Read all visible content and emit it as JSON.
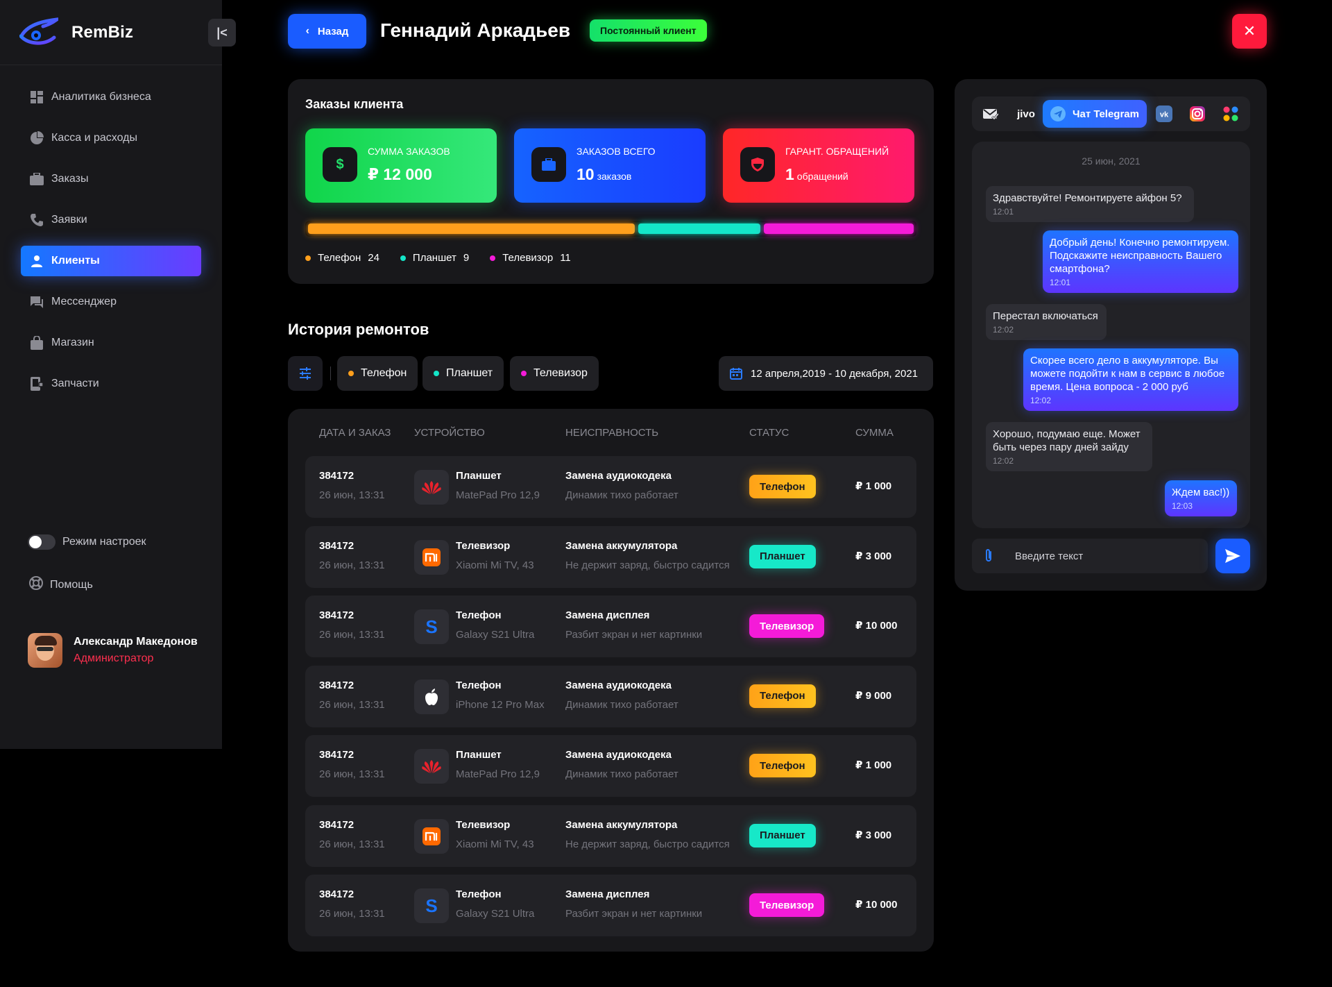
{
  "app": {
    "name": "RemBiz",
    "collapse_glyph": "|<"
  },
  "sidebar": {
    "items": [
      {
        "label": "Аналитика бизнеса",
        "icon": "dashboard-icon"
      },
      {
        "label": "Касса и расходы",
        "icon": "pie-chart-icon"
      },
      {
        "label": "Заказы",
        "icon": "briefcase-icon"
      },
      {
        "label": "Заявки",
        "icon": "phone-icon"
      },
      {
        "label": "Клиенты",
        "icon": "user-icon",
        "active": true
      },
      {
        "label": "Мессенджер",
        "icon": "chat-icon"
      },
      {
        "label": "Магазин",
        "icon": "shopping-bag-icon"
      },
      {
        "label": "Запчасти",
        "icon": "device-icon"
      }
    ],
    "settings_toggle": {
      "label": "Режим настроек",
      "on": false
    },
    "help_label": "Помощь",
    "user": {
      "name": "Александр Македонов",
      "role": "Администратор"
    }
  },
  "header": {
    "back_label": "Назад",
    "client_name": "Геннадий Аркадьев",
    "client_badge": "Постоянный клиент"
  },
  "orders": {
    "title": "Заказы клиента",
    "stats": [
      {
        "label": "Сумма заказов",
        "value": "₽ 12 000",
        "unit": "",
        "icon": "dollar-icon",
        "color": "#10d54a"
      },
      {
        "label": "Заказов всего",
        "value": "10",
        "unit": "заказов",
        "icon": "briefcase-icon",
        "color": "#1663ff"
      },
      {
        "label": "Гарант. обращений",
        "value": "1",
        "unit": "обращений",
        "icon": "shield-icon",
        "color": "#ff2727"
      }
    ],
    "breakdown": [
      {
        "name": "Телефон",
        "count": 24,
        "color": "#ff9f1c"
      },
      {
        "name": "Планшет",
        "count": 9,
        "color": "#14e6c8"
      },
      {
        "name": "Телевизор",
        "count": 11,
        "color": "#f41bd8"
      }
    ]
  },
  "history": {
    "title": "История ремонтов",
    "filters": [
      "Телефон",
      "Планшет",
      "Телевизор"
    ],
    "date_range": "12 апреля,2019 - 10 декабря, 2021",
    "columns": [
      "Дата и заказ",
      "Устройство",
      "Неисправность",
      "Статус",
      "Сумма"
    ],
    "rows": [
      {
        "order": "384172",
        "date": "26 июн, 13:31",
        "brand": "huawei-logo-icon",
        "device": "Планшет",
        "model": "MatePad Pro 12,9",
        "fault": "Замена аудиокодека",
        "fault_desc": "Динамик тихо работает",
        "status": "Телефон",
        "status_color": "orange",
        "sum": "₽ 1 000"
      },
      {
        "order": "384172",
        "date": "26 июн, 13:31",
        "brand": "xiaomi-logo-icon",
        "device": "Телевизор",
        "model": "Xiaomi Mi TV, 43",
        "fault": "Замена аккумулятора",
        "fault_desc": "Не держит заряд, быстро садится",
        "status": "Планшет",
        "status_color": "teal",
        "sum": "₽ 3 000"
      },
      {
        "order": "384172",
        "date": "26 июн, 13:31",
        "brand": "samsung-logo-icon",
        "device": "Телефон",
        "model": "Galaxy S21 Ultra",
        "fault": "Замена дисплея",
        "fault_desc": "Разбит экран и нет картинки",
        "status": "Телевизор",
        "status_color": "magenta",
        "sum": "₽ 10 000"
      },
      {
        "order": "384172",
        "date": "26 июн, 13:31",
        "brand": "apple-logo-icon",
        "device": "Телефон",
        "model": "iPhone 12 Pro Max",
        "fault": "Замена аудиокодека",
        "fault_desc": "Динамик тихо работает",
        "status": "Телефон",
        "status_color": "orange",
        "sum": "₽ 9 000"
      },
      {
        "order": "384172",
        "date": "26 июн, 13:31",
        "brand": "huawei-logo-icon",
        "device": "Планшет",
        "model": "MatePad Pro 12,9",
        "fault": "Замена аудиокодека",
        "fault_desc": "Динамик тихо работает",
        "status": "Телефон",
        "status_color": "orange",
        "sum": "₽ 1 000"
      },
      {
        "order": "384172",
        "date": "26 июн, 13:31",
        "brand": "xiaomi-logo-icon",
        "device": "Телевизор",
        "model": "Xiaomi Mi TV, 43",
        "fault": "Замена аккумулятора",
        "fault_desc": "Не держит заряд, быстро садится",
        "status": "Планшет",
        "status_color": "teal",
        "sum": "₽ 3 000"
      },
      {
        "order": "384172",
        "date": "26 июн, 13:31",
        "brand": "samsung-logo-icon",
        "device": "Телефон",
        "model": "Galaxy S21 Ultra",
        "fault": "Замена дисплея",
        "fault_desc": "Разбит экран и нет картинки",
        "status": "Телевизор",
        "status_color": "magenta",
        "sum": "₽ 10 000"
      }
    ]
  },
  "chat": {
    "tabs": [
      "mail-icon",
      "jivo",
      "Чат Telegram",
      "vk-icon",
      "instagram-icon",
      "apps-icon"
    ],
    "active_tab": "Чат Telegram",
    "day": "25 июн, 2021",
    "messages": [
      {
        "dir": "in",
        "text": "Здравствуйте! Ремонтируете айфон 5?",
        "time": "12:01"
      },
      {
        "dir": "out",
        "text": "Добрый день! Конечно ремонтируем. Подскажите неисправность Вашего смартфона?",
        "time": "12:01"
      },
      {
        "dir": "in",
        "text": "Перестал включаться",
        "time": "12:02"
      },
      {
        "dir": "out",
        "text": "Скорее всего дело в аккумуляторе. Вы можете подойти к нам в сервис в любое время. Цена вопроса - 2 000 руб",
        "time": "12:02"
      },
      {
        "dir": "in",
        "text": "Хорошо, подумаю еще. Может быть через пару дней зайду",
        "time": "12:02"
      },
      {
        "dir": "out",
        "text": "Ждем вас!))",
        "time": "12:03"
      }
    ],
    "input_placeholder": "Введите текст"
  }
}
